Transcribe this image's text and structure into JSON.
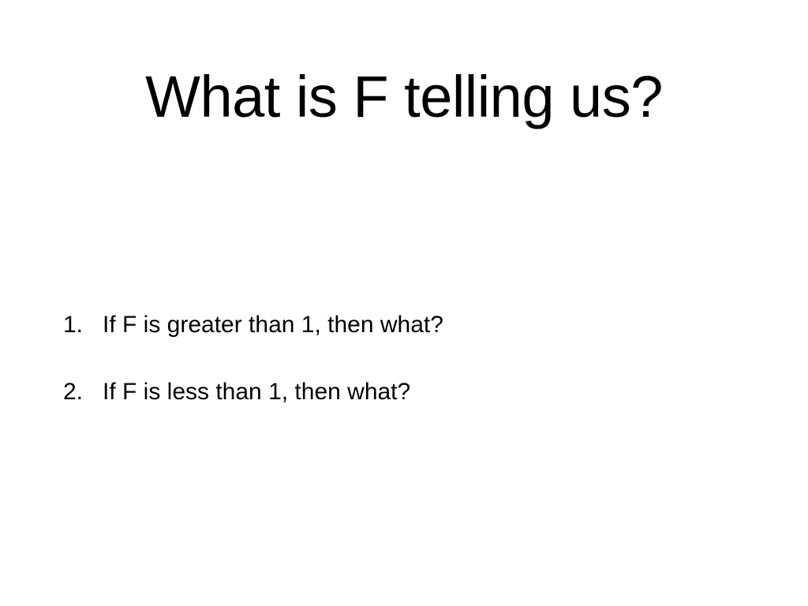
{
  "slide": {
    "title": "What is F telling us?",
    "questions": [
      {
        "number": "1.",
        "text": "If F is greater than 1, then what?"
      },
      {
        "number": "2.",
        "text": "If F is less than 1, then what?"
      }
    ]
  }
}
